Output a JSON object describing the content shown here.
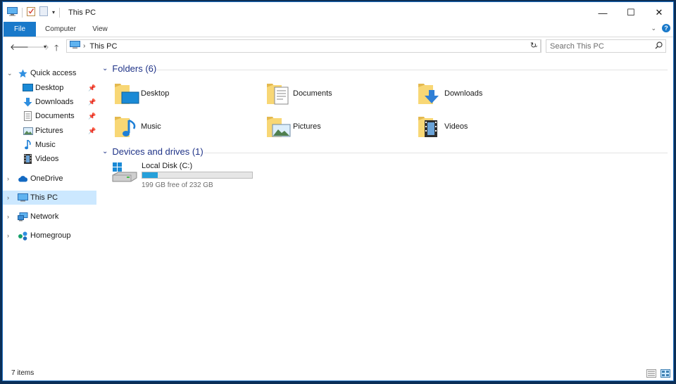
{
  "window": {
    "title": "This PC",
    "controls": {
      "minimize": "—",
      "maximize": "☐",
      "close": "✕"
    }
  },
  "ribbon": {
    "tabs": [
      {
        "label": "File",
        "active": true
      },
      {
        "label": "Computer"
      },
      {
        "label": "View"
      }
    ]
  },
  "address": {
    "path": [
      "This PC"
    ],
    "search_placeholder": "Search This PC"
  },
  "sidebar": {
    "items": [
      {
        "label": "Quick access",
        "icon": "star-icon",
        "expanded": true
      },
      {
        "label": "Desktop",
        "icon": "desktop-icon",
        "pinned": true
      },
      {
        "label": "Downloads",
        "icon": "download-arrow-icon",
        "pinned": true
      },
      {
        "label": "Documents",
        "icon": "document-icon",
        "pinned": true
      },
      {
        "label": "Pictures",
        "icon": "pictures-icon",
        "pinned": true
      },
      {
        "label": "Music",
        "icon": "music-note-icon"
      },
      {
        "label": "Videos",
        "icon": "film-icon"
      },
      {
        "label": "OneDrive",
        "icon": "cloud-icon"
      },
      {
        "label": "This PC",
        "icon": "computer-icon",
        "selected": true
      },
      {
        "label": "Network",
        "icon": "network-icon"
      },
      {
        "label": "Homegroup",
        "icon": "homegroup-icon"
      }
    ]
  },
  "main": {
    "folders_header": "Folders (6)",
    "folders": [
      {
        "label": "Desktop",
        "overlay": "desktop"
      },
      {
        "label": "Documents",
        "overlay": "documents"
      },
      {
        "label": "Downloads",
        "overlay": "downloads"
      },
      {
        "label": "Music",
        "overlay": "music"
      },
      {
        "label": "Pictures",
        "overlay": "pictures"
      },
      {
        "label": "Videos",
        "overlay": "videos"
      }
    ],
    "drives_header": "Devices and drives (1)",
    "drives": [
      {
        "label": "Local Disk (C:)",
        "free_text": "199 GB free of 232 GB",
        "used_fraction": 0.142
      }
    ]
  },
  "status": {
    "items_text": "7 items"
  },
  "colors": {
    "accent": "#1979ca",
    "selection": "#cce8ff",
    "group_header": "#1e3287",
    "folder": "#f8d775",
    "drive_fill": "#26a0da"
  }
}
